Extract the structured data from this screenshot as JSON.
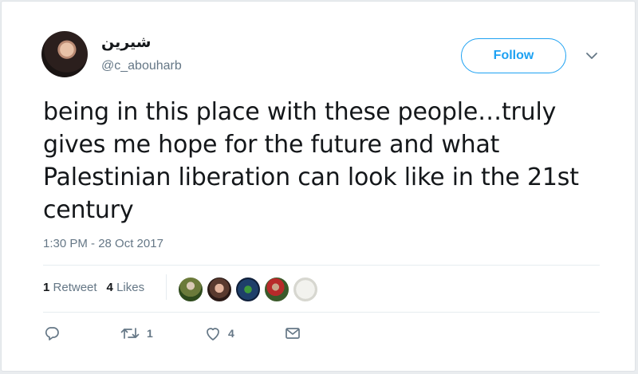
{
  "user": {
    "display_name": "شيرين",
    "handle": "@c_abouharb"
  },
  "follow_label": "Follow",
  "tweet": {
    "text": "being in this place with these people…truly gives me hope for the future and what Palestinian liberation can look like in the 21st century",
    "timestamp": "1:30 PM - 28 Oct 2017"
  },
  "stats": {
    "retweets_count": "1",
    "retweets_label": "Retweet",
    "likes_count": "4",
    "likes_label": "Likes"
  },
  "liker_avatar_count": 5,
  "actions": {
    "reply_count": "",
    "retweet_count": "1",
    "like_count": "4"
  },
  "colors": {
    "accent": "#1da1f2",
    "text": "#14171a",
    "muted": "#657786"
  },
  "icons": [
    "reply-icon",
    "retweet-icon",
    "like-icon",
    "direct-message-icon",
    "chevron-down-icon"
  ]
}
